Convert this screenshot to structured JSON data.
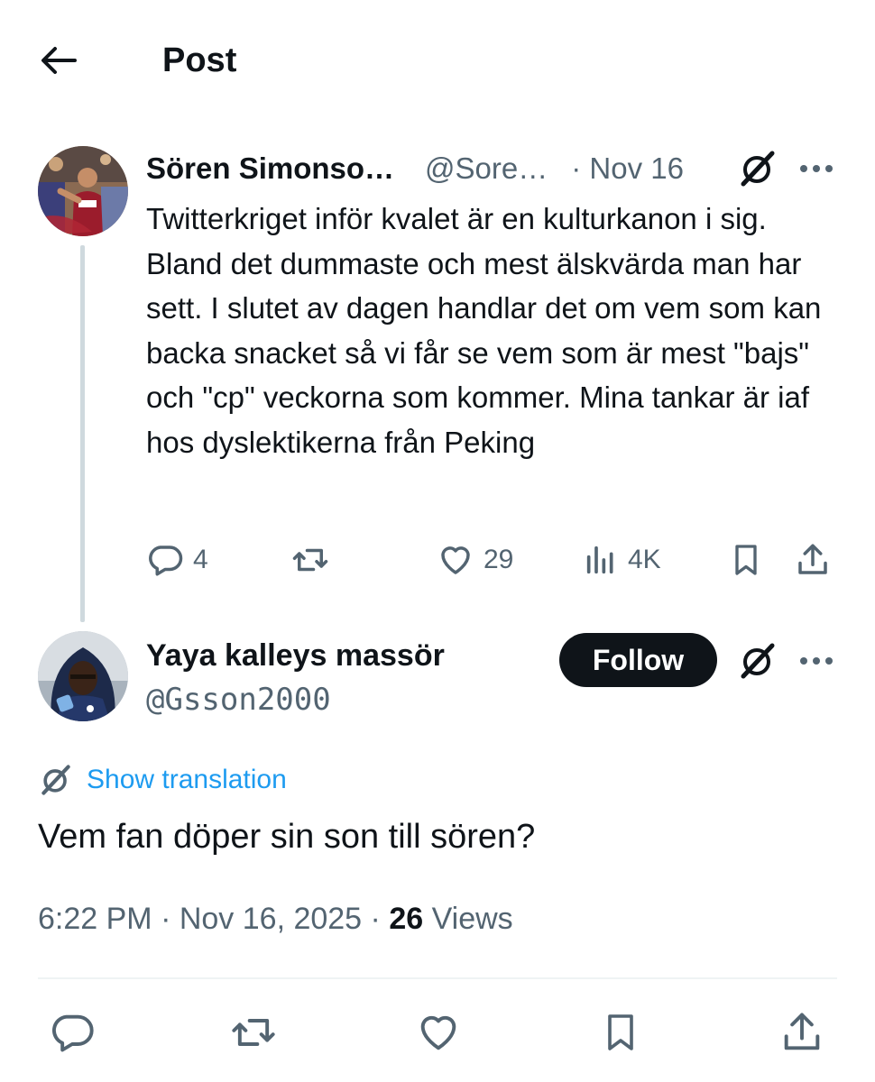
{
  "header": {
    "title": "Post",
    "back_icon": "arrow-left-icon"
  },
  "original_tweet": {
    "author_name": "Sören Simonso…",
    "author_handle": "@Sore…",
    "date": "· Nov 16",
    "text": "Twitterkriget inför kvalet är en kulturkanon i sig. Bland det dummaste och mest älskvärda man har sett. I slutet av dagen handlar det om vem som kan backa snacket så vi får se vem som är mest \"bajs\" och \"cp\" veckorna som kommer. Mina tankar är iaf hos dyslektikerna från Peking",
    "replies": "4",
    "likes": "29",
    "views": "4K"
  },
  "reply_tweet": {
    "author_name": "Yaya kalleys massör",
    "author_handle": "@Gsson2000",
    "follow_label": "Follow",
    "show_translation": "Show translation",
    "text": "Vem fan döper sin son till sören?",
    "time": "6:22 PM · Nov 16, 2025 · ",
    "views_count": "26",
    "views_label": " Views"
  },
  "colors": {
    "text": "#0f1419",
    "secondary": "#536471",
    "link": "#1d9bf0",
    "border": "#eff3f4",
    "thread_line": "#cfd9de"
  }
}
